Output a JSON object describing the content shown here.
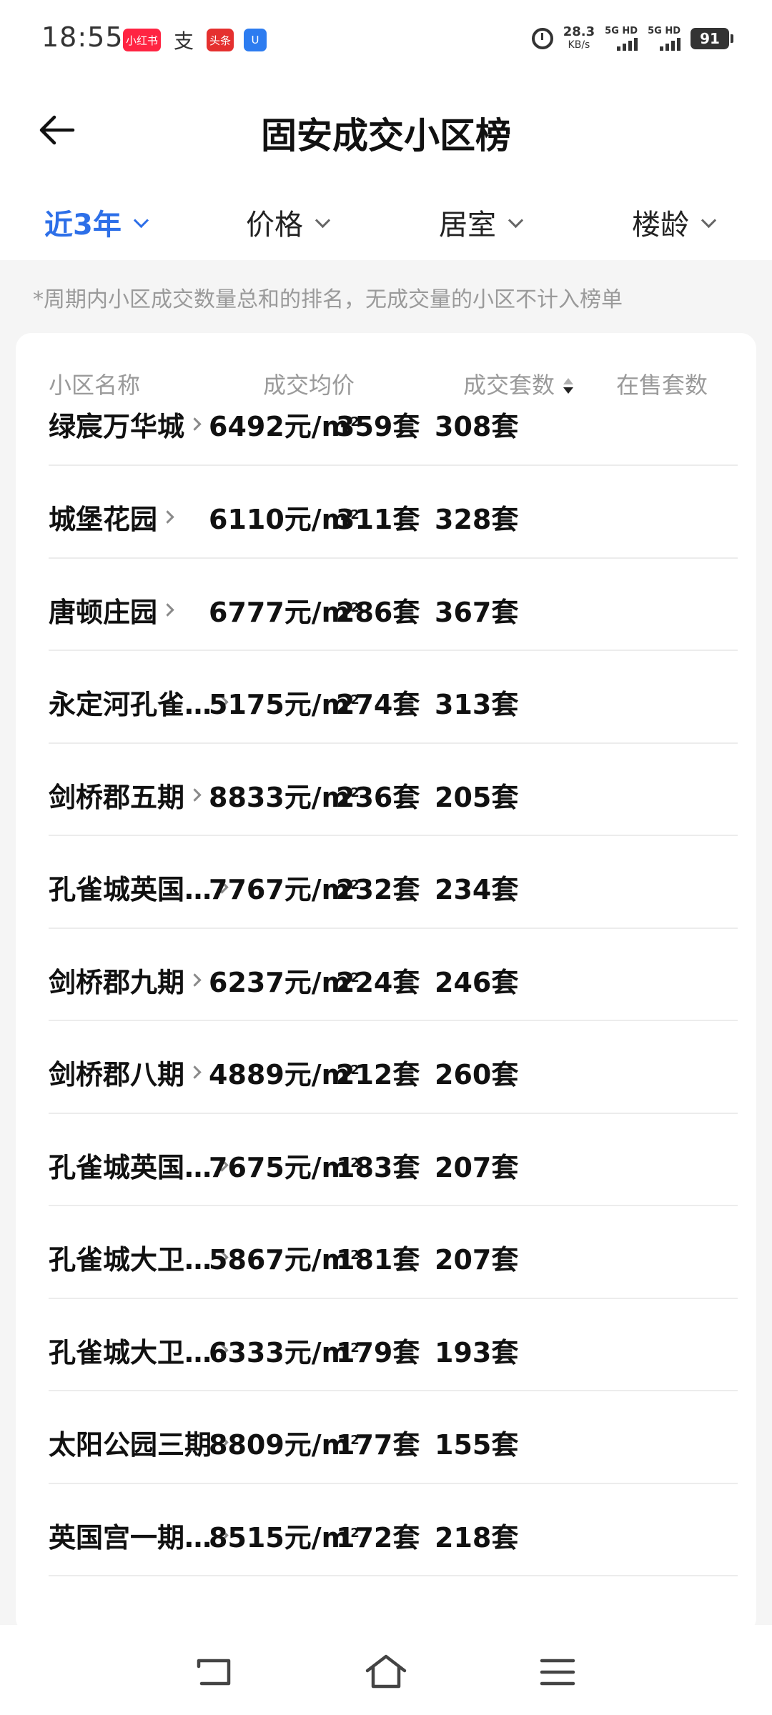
{
  "status_bar": {
    "time": "18:55",
    "notifications": [
      {
        "name": "xiaohongshu-icon",
        "label": "小红书",
        "color": "#ff2442"
      },
      {
        "name": "alipay-icon",
        "label": "支",
        "color": "#333333"
      },
      {
        "name": "toutiao-icon",
        "label": "头条",
        "color": "#e5302f"
      },
      {
        "name": "app-notif-icon",
        "label": "U",
        "color": "#2d7cf0"
      }
    ],
    "net_speed": "28.3",
    "net_unit": "KB/s",
    "signal1_label": "5G HD",
    "signal2_label": "5G HD",
    "battery": "91"
  },
  "header": {
    "title": "固安成交小区榜"
  },
  "filters": [
    {
      "label": "近3年",
      "active": true
    },
    {
      "label": "价格",
      "active": false
    },
    {
      "label": "居室",
      "active": false
    },
    {
      "label": "楼龄",
      "active": false
    }
  ],
  "note": "*周期内小区成交数量总和的排名，无成交量的小区不计入榜单",
  "table": {
    "headers": {
      "name": "小区名称",
      "price": "成交均价",
      "sold": "成交套数",
      "on_sale": "在售套数"
    },
    "price_unit": "元/m",
    "rows": [
      {
        "name": "绿宸万华城",
        "price": "6492",
        "sold": "359套",
        "on_sale": "308套"
      },
      {
        "name": "城堡花园",
        "price": "6110",
        "sold": "311套",
        "on_sale": "328套"
      },
      {
        "name": "唐顿庄园",
        "price": "6777",
        "sold": "286套",
        "on_sale": "367套"
      },
      {
        "name": "永定河孔雀…",
        "price": "5175",
        "sold": "274套",
        "on_sale": "313套"
      },
      {
        "name": "剑桥郡五期",
        "price": "8833",
        "sold": "236套",
        "on_sale": "205套"
      },
      {
        "name": "孔雀城英国…",
        "price": "7767",
        "sold": "232套",
        "on_sale": "234套"
      },
      {
        "name": "剑桥郡九期",
        "price": "6237",
        "sold": "224套",
        "on_sale": "246套"
      },
      {
        "name": "剑桥郡八期",
        "price": "4889",
        "sold": "212套",
        "on_sale": "260套"
      },
      {
        "name": "孔雀城英国…",
        "price": "7675",
        "sold": "183套",
        "on_sale": "207套"
      },
      {
        "name": "孔雀城大卫…",
        "price": "5867",
        "sold": "181套",
        "on_sale": "207套"
      },
      {
        "name": "孔雀城大卫…",
        "price": "6333",
        "sold": "179套",
        "on_sale": "193套"
      },
      {
        "name": "太阳公园三期",
        "price": "8809",
        "sold": "177套",
        "on_sale": "155套"
      },
      {
        "name": "英国宫一期…",
        "price": "8515",
        "sold": "172套",
        "on_sale": "218套"
      }
    ]
  },
  "nav": {
    "back": "back-nav-icon",
    "home": "home-nav-icon",
    "menu": "menu-nav-icon"
  }
}
